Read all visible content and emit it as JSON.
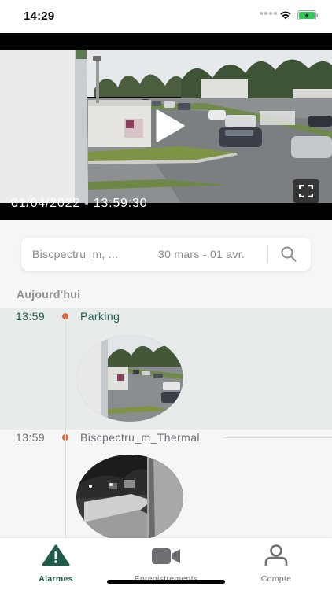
{
  "status_bar": {
    "time": "14:29",
    "wifi_icon": "wifi-icon",
    "battery_icon": "battery-charging-icon",
    "battery_color": "#35c759"
  },
  "video": {
    "timestamp": "01/04/2022 - 13:59:30",
    "play_icon": "play-icon",
    "fullscreen_icon": "fullscreen-icon"
  },
  "search": {
    "camera": "Biscpectru_m, ...",
    "date_range": "30 mars - 01 avr.",
    "icon": "search-icon"
  },
  "timeline": {
    "section_title": "Aujourd'hui",
    "events": [
      {
        "time": "13:59",
        "label": "Parking",
        "selected": true,
        "thumbnail": "parking-camera-snapshot"
      },
      {
        "time": "13:59",
        "label": "Biscpectru_m_Thermal",
        "selected": false,
        "thumbnail": "thermal-camera-snapshot"
      }
    ]
  },
  "colors": {
    "accent": "#1f5c4c",
    "event_dot": "#d86a3c",
    "selected_row": "#e7eceb",
    "inactive": "#6e6e73"
  },
  "tab_bar": {
    "tabs": [
      {
        "label": "Alarmes",
        "icon": "warning-triangle-icon",
        "active": true
      },
      {
        "label": "Enregistrements",
        "icon": "video-camera-icon",
        "active": false
      },
      {
        "label": "Compte",
        "icon": "person-icon",
        "active": false
      }
    ]
  }
}
